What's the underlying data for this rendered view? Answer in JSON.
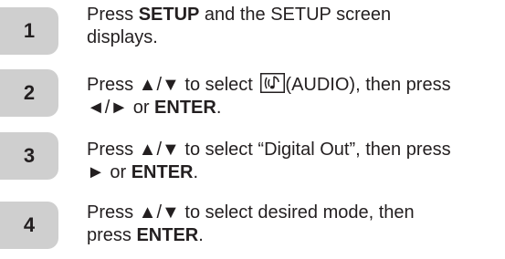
{
  "steps": [
    {
      "number": "1",
      "parts": [
        "Press ",
        "SETUP",
        " and the SETUP screen",
        "displays."
      ]
    },
    {
      "number": "2",
      "parts": [
        "Press ▲/▼ to select ",
        "(AUDIO), then press",
        "◄/► or ",
        "ENTER",
        "."
      ],
      "icon": "audio-music-note-icon"
    },
    {
      "number": "3",
      "parts": [
        "Press ▲/▼ to select “Digital Out”, then press",
        "► or ",
        "ENTER",
        "."
      ]
    },
    {
      "number": "4",
      "parts": [
        "Press ▲/▼ to select desired mode, then",
        "press ",
        "ENTER",
        "."
      ]
    }
  ],
  "colors": {
    "badge_bg": "#cfcfcf",
    "text": "#231f20"
  }
}
